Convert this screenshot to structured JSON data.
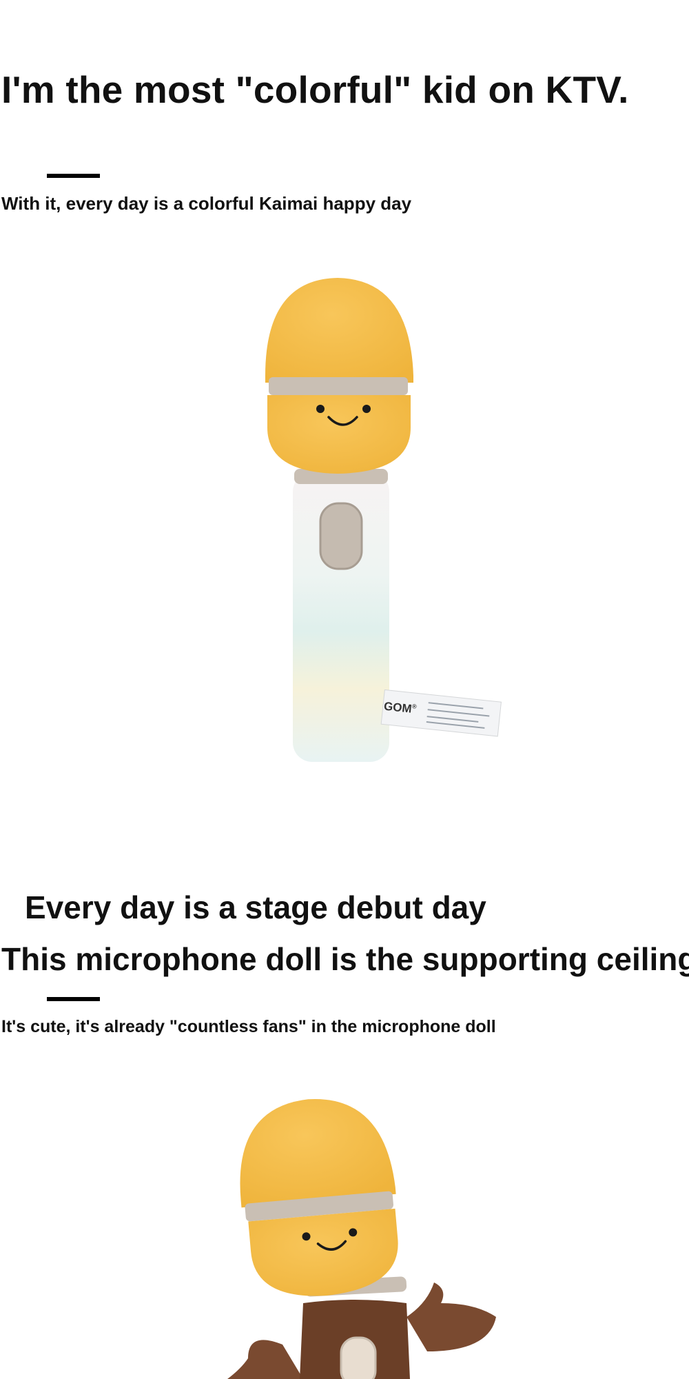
{
  "section1": {
    "heading": "I'm the most \"colorful\" kid on KTV.",
    "subheading": "With it, every day is a colorful Kaimai happy day"
  },
  "product_photo_1": {
    "tag_brand": "GOM",
    "tag_mark": "®"
  },
  "section2": {
    "heading_line1": "Every day is a stage debut day",
    "heading_line2": "This microphone doll is the supporting ceiling",
    "subheading": "It's cute, it's already \"countless fans\" in the microphone doll"
  },
  "colors": {
    "plush_yellow": "#f6bf45",
    "band_gray": "#c9bfb4",
    "handle_white": "#f4f6f2",
    "brown_body": "#6b3f27"
  }
}
